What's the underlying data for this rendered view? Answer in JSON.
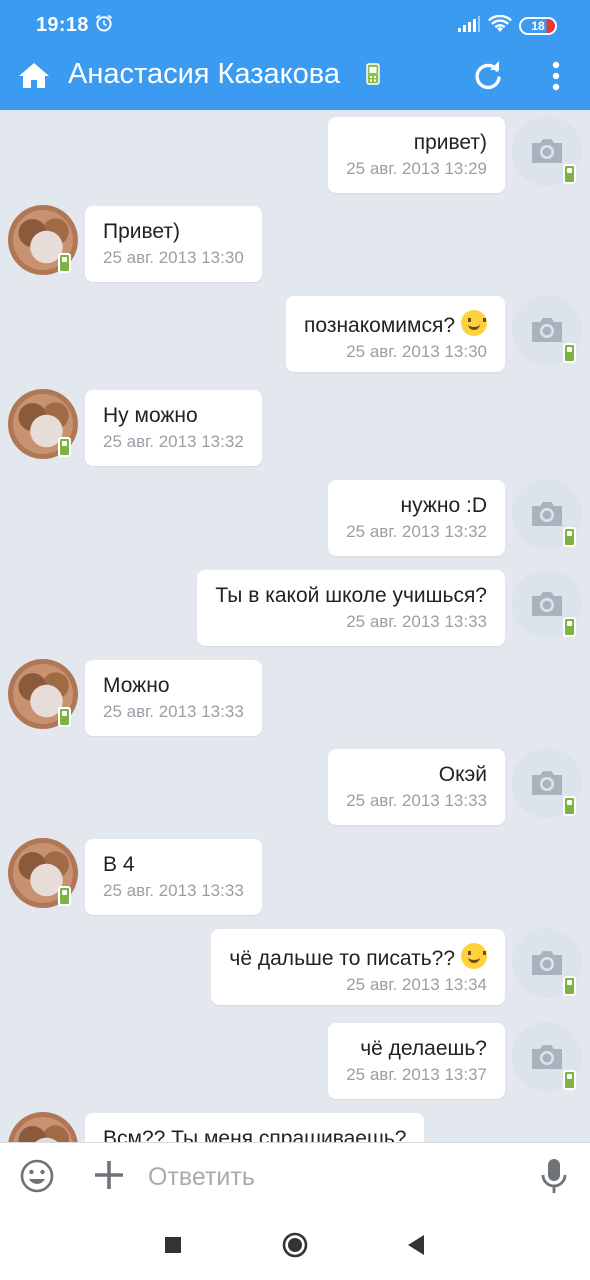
{
  "status_bar": {
    "time": "19:18",
    "battery": "18"
  },
  "header": {
    "title": "Анастасия Казакова"
  },
  "messages": [
    {
      "direction": "out",
      "text": "привет)",
      "time": "25 авг. 2013 13:29"
    },
    {
      "direction": "in",
      "text": "Привет)",
      "time": "25 авг. 2013 13:30"
    },
    {
      "direction": "out",
      "text": "познакомимся?",
      "emoji": "wink",
      "time": "25 авг. 2013 13:30"
    },
    {
      "direction": "in",
      "text": "Ну можно",
      "time": "25 авг. 2013 13:32"
    },
    {
      "direction": "out",
      "text": "нужно :D",
      "time": "25 авг. 2013 13:32"
    },
    {
      "direction": "out",
      "text": "Ты в какой школе учишься?",
      "time": "25 авг. 2013 13:33"
    },
    {
      "direction": "in",
      "text": "Можно",
      "time": "25 авг. 2013 13:33"
    },
    {
      "direction": "out",
      "text": "Окэй",
      "time": "25 авг. 2013 13:33"
    },
    {
      "direction": "in",
      "text": "В 4",
      "time": "25 авг. 2013 13:33"
    },
    {
      "direction": "out",
      "text": "чё дальше то писать??",
      "emoji": "laugh",
      "time": "25 авг. 2013 13:34"
    },
    {
      "direction": "out",
      "text": "чё делаешь?",
      "time": "25 авг. 2013 13:37"
    },
    {
      "direction": "in",
      "text": "Всм?? Ты меня спрашиваешь?",
      "time": ""
    }
  ],
  "composer": {
    "placeholder": "Ответить"
  },
  "icons": {
    "home": "home-icon",
    "refresh": "refresh-icon",
    "more": "more-vertical-icon",
    "smile": "smile-icon",
    "plus": "plus-icon",
    "mic": "microphone-icon",
    "avatar_placeholder": "camera-icon",
    "online": "mobile-online-icon"
  },
  "colors": {
    "accent": "#3a9bf0",
    "background": "#e3e7ee",
    "online_badge": "#7cb342"
  }
}
